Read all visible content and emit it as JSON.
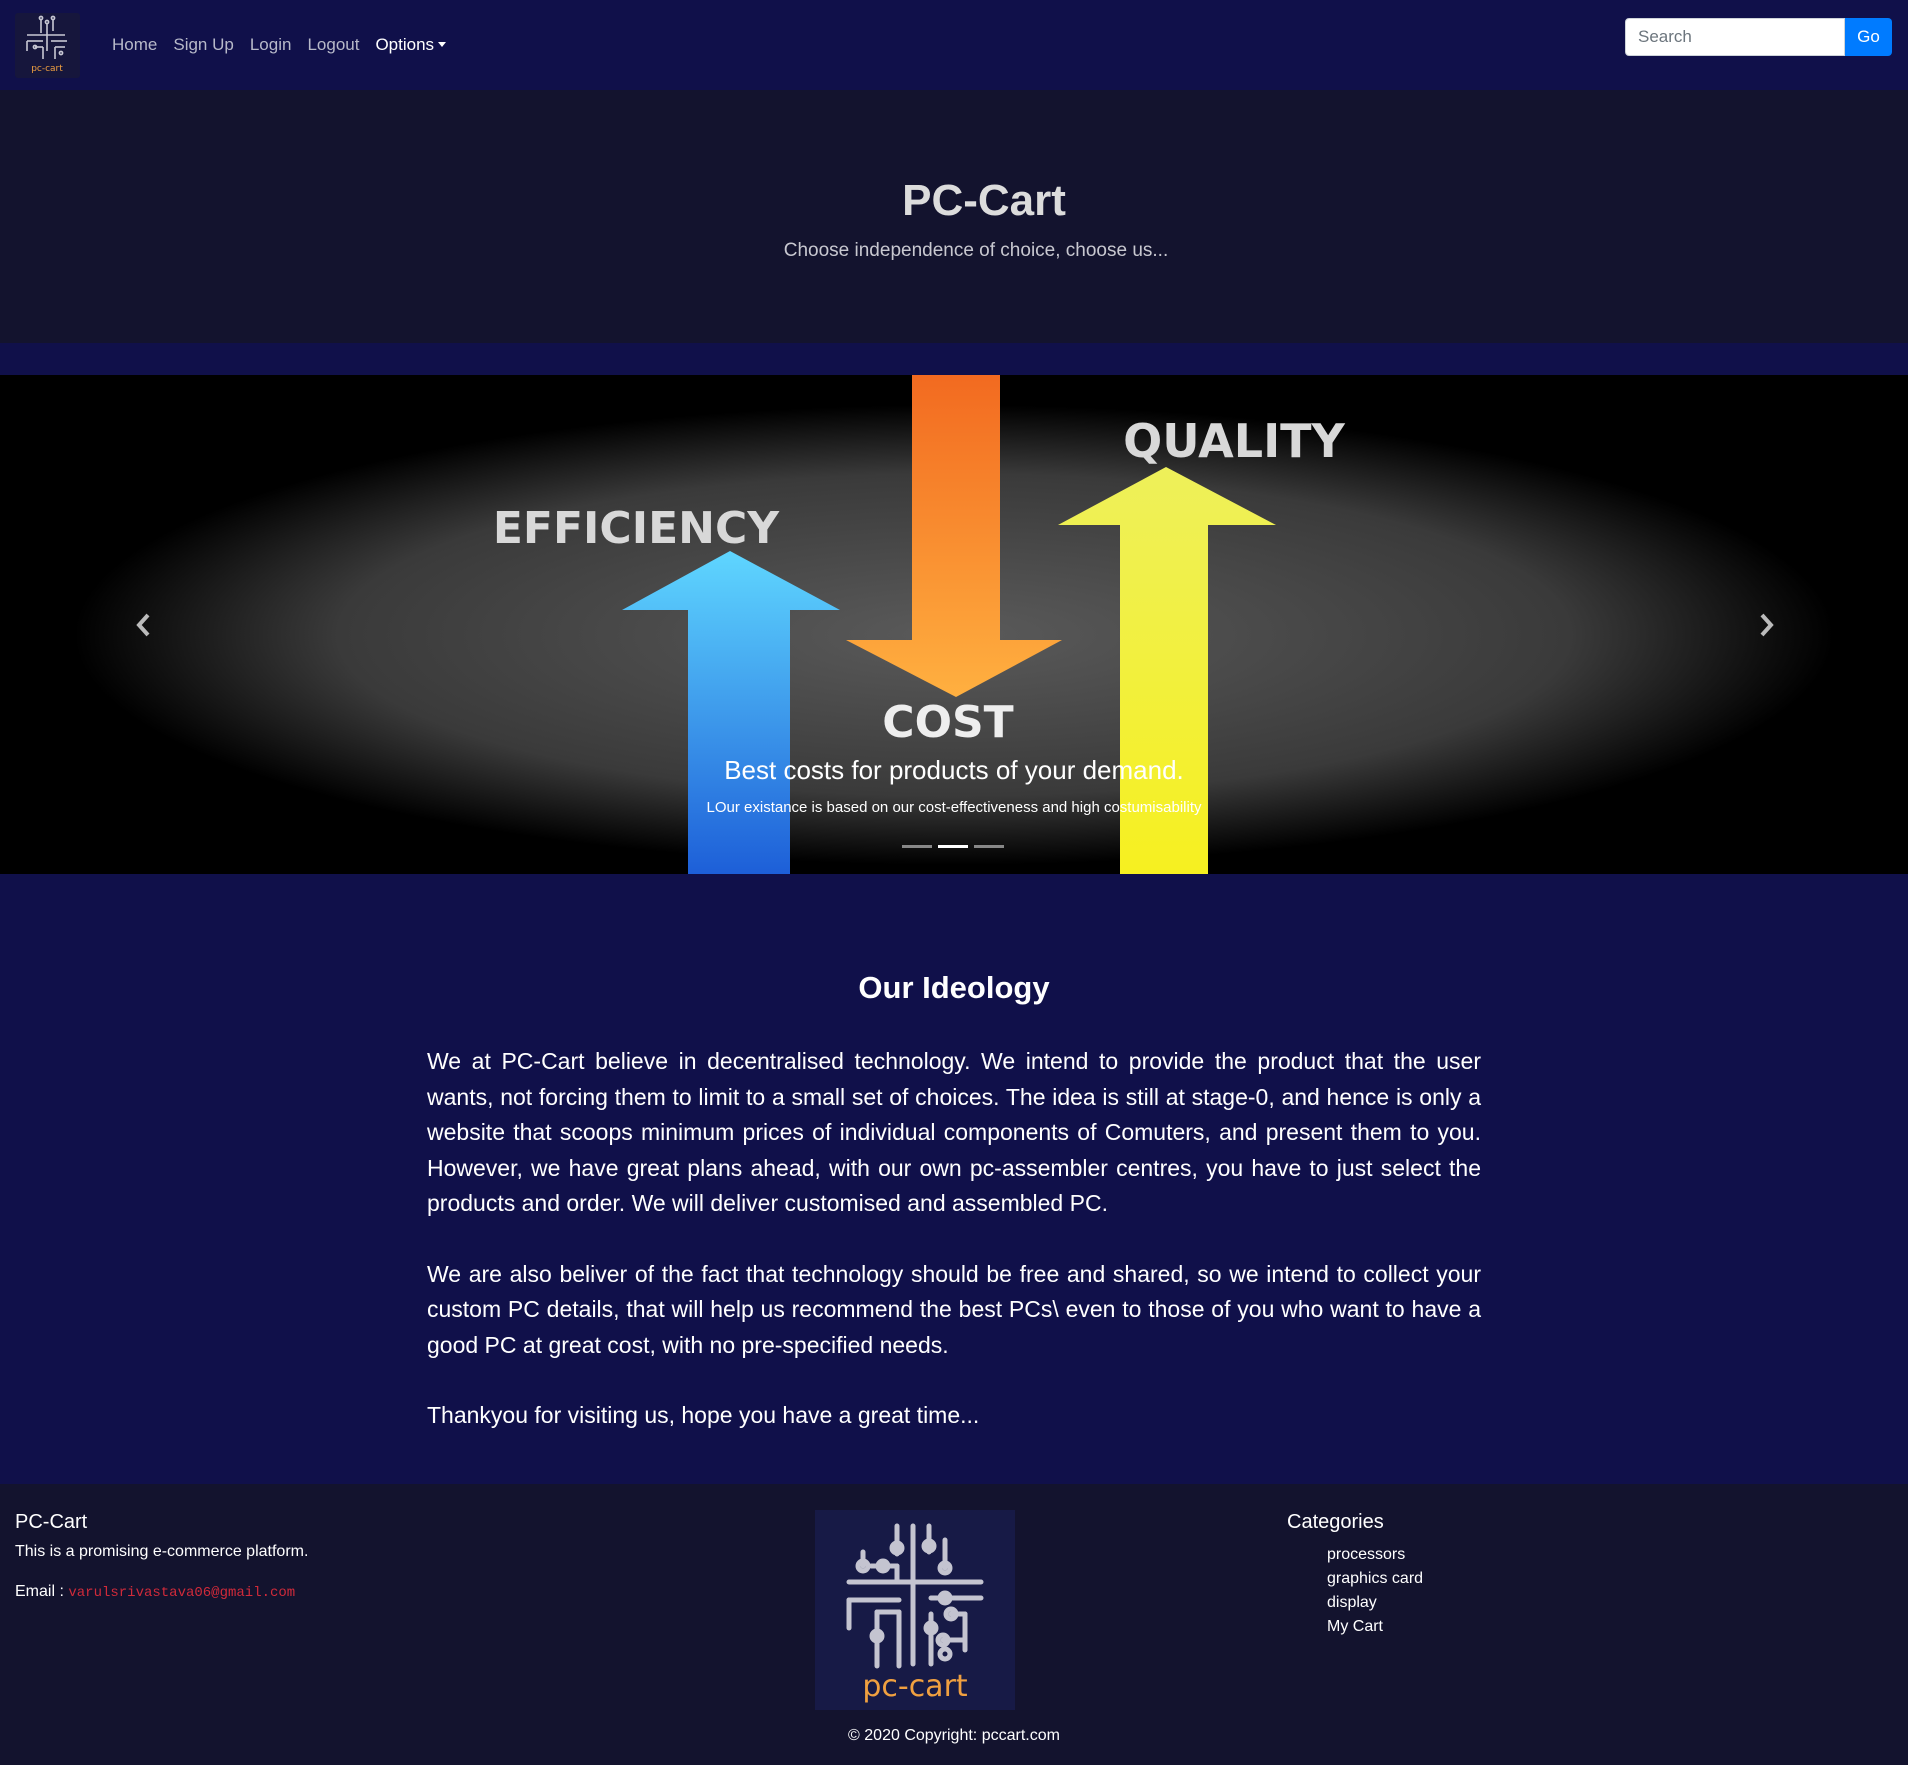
{
  "navbar": {
    "logo_text": "pc-cart",
    "links": [
      "Home",
      "Sign Up",
      "Login",
      "Logout"
    ],
    "options_label": "Options",
    "search_placeholder": "Search",
    "search_button": "Go"
  },
  "hero": {
    "title": "PC-Cart",
    "subtitle": "Choose independence of choice, choose us..."
  },
  "carousel": {
    "image_words": [
      "EFFICIENCY",
      "QUALITY",
      "COST"
    ],
    "caption_title": "Best costs for products of your demand.",
    "caption_text": "LOur existance is based on our cost-effectiveness and high costumisability",
    "active_slide": 2,
    "slide_count": 3
  },
  "ideology": {
    "heading": "Our Ideology",
    "paragraphs": [
      "We at PC-Cart believe in decentralised technology. We intend to provide the product that the user wants, not forcing them to limit to a small set of choices. The idea is still at stage-0, and hence is only a website that scoops minimum prices of individual components of Comuters, and present them to you. However, we have great plans ahead, with our own pc-assembler centres, you have to just select the products and order. We will deliver customised and assembled PC.",
      "We are also beliver of the fact that technology should be free and shared, so we intend to collect your custom PC details, that will help us recommend the best PCs\\ even to those of you who want to have a good PC at great cost, with no pre-specified needs.",
      "Thankyou for visiting us, hope you have a great time..."
    ]
  },
  "footer": {
    "title": "PC-Cart",
    "description": "This is a promising e-commerce platform.",
    "email_label": "Email :",
    "email": "varulsrivastava06@gmail.com",
    "logo_text": "pc-cart",
    "categories_title": "Categories",
    "categories": [
      "processors",
      "graphics card",
      "display",
      "My Cart"
    ],
    "copyright": "© 2020 Copyright: pccart.com"
  },
  "colors": {
    "navy": "#10104a",
    "dark": "#13132e",
    "primary": "#007bff",
    "logo_orange": "#f0a040"
  }
}
